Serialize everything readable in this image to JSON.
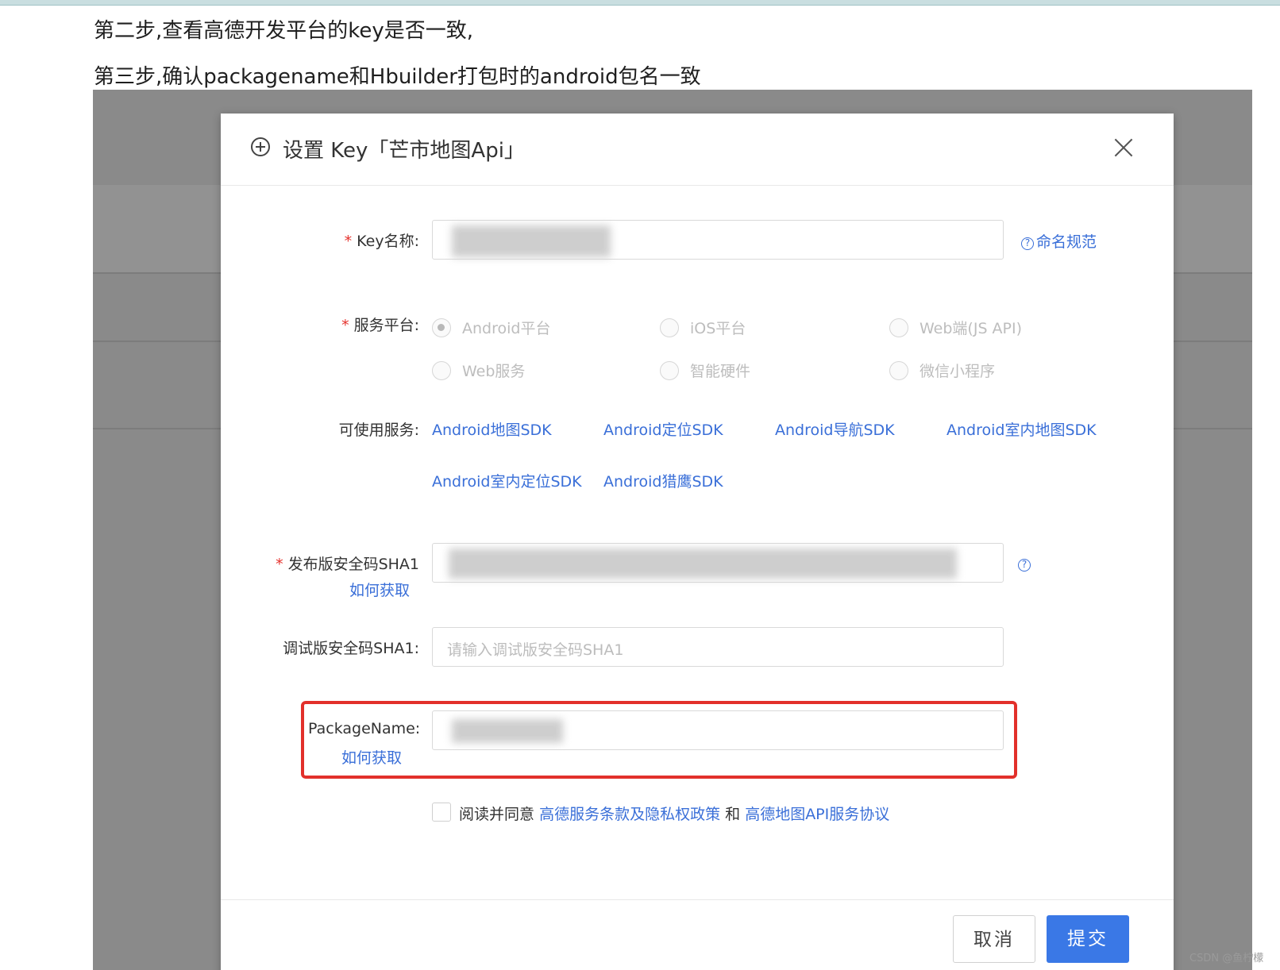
{
  "article": {
    "step2": "第二步,查看高德开发平台的key是否一致,",
    "step3": "第三步,确认packagename和Hbuilder打包时的android包名一致"
  },
  "dialog": {
    "title": "设置 Key「芒市地图Api」",
    "fields": {
      "key_name_label": "Key名称:",
      "naming_rule_link": "命名规范",
      "platform_label": "服务平台:",
      "platforms": [
        {
          "label": "Android平台",
          "selected": true
        },
        {
          "label": "iOS平台",
          "selected": false
        },
        {
          "label": "Web端(JS API)",
          "selected": false
        },
        {
          "label": "Web服务",
          "selected": false
        },
        {
          "label": "智能硬件",
          "selected": false
        },
        {
          "label": "微信小程序",
          "selected": false
        }
      ],
      "services_label": "可使用服务:",
      "services": [
        "Android地图SDK",
        "Android定位SDK",
        "Android导航SDK",
        "Android室内地图SDK",
        "Android室内定位SDK",
        "Android猎鹰SDK"
      ],
      "release_sha1_label": "发布版安全码SHA1",
      "how_to_get": "如何获取",
      "debug_sha1_label": "调试版安全码SHA1:",
      "debug_sha1_placeholder": "请输入调试版安全码SHA1",
      "package_name_label": "PackageName:",
      "package_how_to_get": "如何获取"
    },
    "agreement": {
      "prefix": "阅读并同意",
      "terms_link": "高德服务条款及隐私权政策",
      "and": "和",
      "api_link": "高德地图API服务协议"
    },
    "buttons": {
      "cancel": "取消",
      "submit": "提交"
    }
  },
  "watermark": "CSDN @鱼柠檬",
  "colors": {
    "link": "#3a6fd8",
    "primary": "#3a78e6",
    "highlight": "#e2302b",
    "overlay": "#8a8a8a"
  }
}
